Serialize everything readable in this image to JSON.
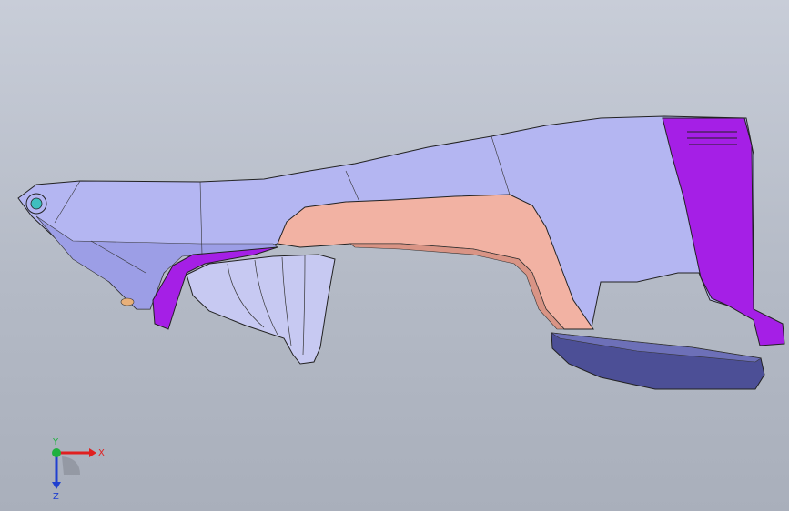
{
  "viewport": {
    "background": "#bcc1cc"
  },
  "model": {
    "body_color": "#b4b6f2",
    "body_shadow": "#9c9ee6",
    "grip_color": "#f2b2a3",
    "accent_color": "#a51fe6",
    "base_color": "#4c4f96",
    "funnel_color": "#c7c9f2",
    "tip_color": "#e8b07a"
  },
  "triad": {
    "x_label": "X",
    "y_label": "Y",
    "z_label": "Z",
    "x_color": "#e02020",
    "y_color": "#20b040",
    "z_color": "#2040d0"
  }
}
